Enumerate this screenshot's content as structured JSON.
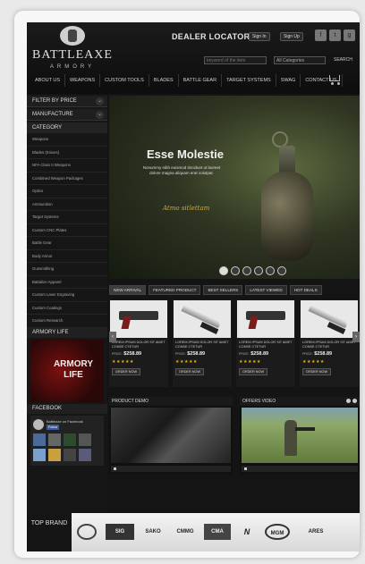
{
  "header": {
    "logo_name": "BATTLEAXE",
    "logo_sub": "ARMORY",
    "dealer_locator": "DEALER LOCATOR",
    "sign_in": "Sign In",
    "sign_up": "Sign Up",
    "social": [
      "f",
      "t",
      "g"
    ],
    "search_placeholder": "keyword of the item",
    "category_select": "All Categories",
    "search_label": "SEARCH"
  },
  "nav": [
    "ABOUT US",
    "WEAPONS",
    "CUSTOM TOOLS",
    "BLADES",
    "BATTLE GEAR",
    "TARGET SYSTEMS",
    "SWAG",
    "CONTACT US"
  ],
  "sidebar": {
    "filter_price": "FILTER BY PRICE",
    "manufacturer": "MANUFACTURE",
    "category_title": "CATEGORY",
    "categories": [
      "Weapons",
      "Blades (Knives)",
      "NFA Class II Weapons",
      "Combined Weapon Packages",
      "Optics",
      "Ammunition",
      "Target Systems",
      "Custom CNC Plates",
      "Battle Gear",
      "Body Armor",
      "Gunsmithing",
      "Battalion Apparel",
      "Custom Laser Engraving",
      "Custom Coatings",
      "Custom Research"
    ],
    "armory_title": "ARMORY LIFE",
    "armory_text": "ARMORY LIFE",
    "facebook_title": "FACEBOOK",
    "fb_name": "Battleaxe on Facebook",
    "fb_like": "Follow"
  },
  "slider": {
    "title": "Esse Molestie",
    "text": "Nonummy nibh euismod tincidunt ut laoreet dolore magna aliquam erat volutpat.",
    "signature": "Atmo sitlettam"
  },
  "tabs": [
    "NEW ARRIVAL",
    "FEATURED PRODUCT",
    "BEST SELLERS",
    "LATEST VIEWED",
    "HOT DEALS"
  ],
  "products": [
    {
      "name": "LOREM IPSUM DOLOR SIT AMET CONSE CTETUR",
      "price_label": "PRICE:",
      "price": "$258.89",
      "order": "ORDER NOW",
      "img": "pistol"
    },
    {
      "name": "LOREM IPSUM DOLOR SIT AMET CONSE CTETUR",
      "price_label": "PRICE:",
      "price": "$258.89",
      "order": "ORDER NOW",
      "img": "knife"
    },
    {
      "name": "LOREM IPSUM DOLOR SIT AMET CONSE CTETUR",
      "price_label": "PRICE:",
      "price": "$258.89",
      "order": "ORDER NOW",
      "img": "pistol"
    },
    {
      "name": "LOREM IPSUM DOLOR SIT AMET CONSE CTETUR",
      "price_label": "PRICE:",
      "price": "$258.89",
      "order": "ORDER NOW",
      "img": "knife"
    }
  ],
  "product_arrows": {
    "prev": "‹",
    "next": "›"
  },
  "stars": "★★★★★",
  "videos": {
    "demo_title": "PRODUCT DEMO",
    "offers_title": "OFFERS VIDEO"
  },
  "brands": {
    "label": "TOP BRAND",
    "items": [
      "SIG",
      "SAKO",
      "CMMG",
      "CMA",
      "N",
      "MGM",
      "ARES"
    ]
  }
}
